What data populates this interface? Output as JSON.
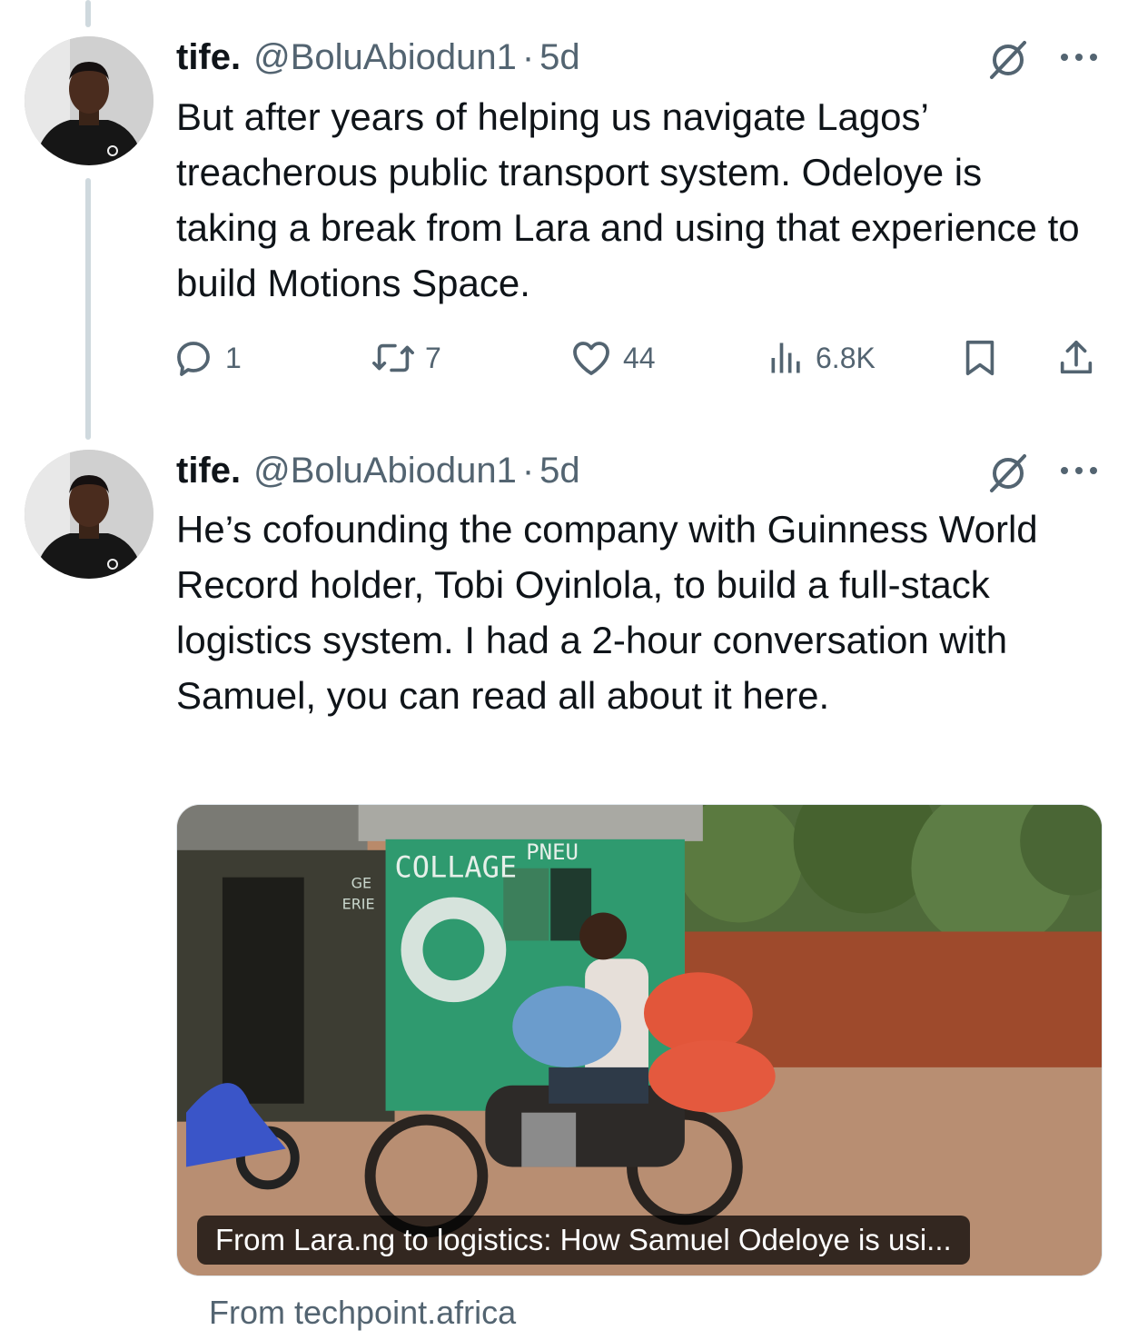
{
  "tweets": [
    {
      "author_name": "tife.",
      "handle": "@BoluAbiodun1",
      "separator": "·",
      "time": "5d",
      "text": "But after years of helping us navigate Lagos’ treacherous public transport system. Odeloye is taking a break from Lara and using that experience to build Motions Space.",
      "replies": "1",
      "reposts": "7",
      "likes": "44",
      "views": "6.8K"
    },
    {
      "author_name": "tife.",
      "handle": "@BoluAbiodun1",
      "separator": "·",
      "time": "5d",
      "text": "He’s cofounding the company with Guinness World Record holder, Tobi Oyinlola, to build a full-stack logistics system. I had a 2-hour conversation with Samuel, you can read all about it here.",
      "card": {
        "title": "From Lara.ng to logistics: How Samuel Odeloye is usi...",
        "source": "From techpoint.africa",
        "image_text": {
          "wall_1": "COLLAGE",
          "wall_2": "PNEU",
          "wall_3": "GE",
          "wall_4": "ERIE"
        }
      }
    }
  ],
  "icons": {
    "reply": "reply-bubble-icon",
    "repost": "repost-arrows-icon",
    "like": "heart-icon",
    "views": "bar-chart-icon",
    "bookmark": "bookmark-icon",
    "share": "share-upload-icon",
    "grok": "grok-slash-circle-icon",
    "more": "more-dots-icon"
  },
  "colors": {
    "text": "#0f1419",
    "secondary": "#536471",
    "thread_line": "#cfd9de"
  }
}
